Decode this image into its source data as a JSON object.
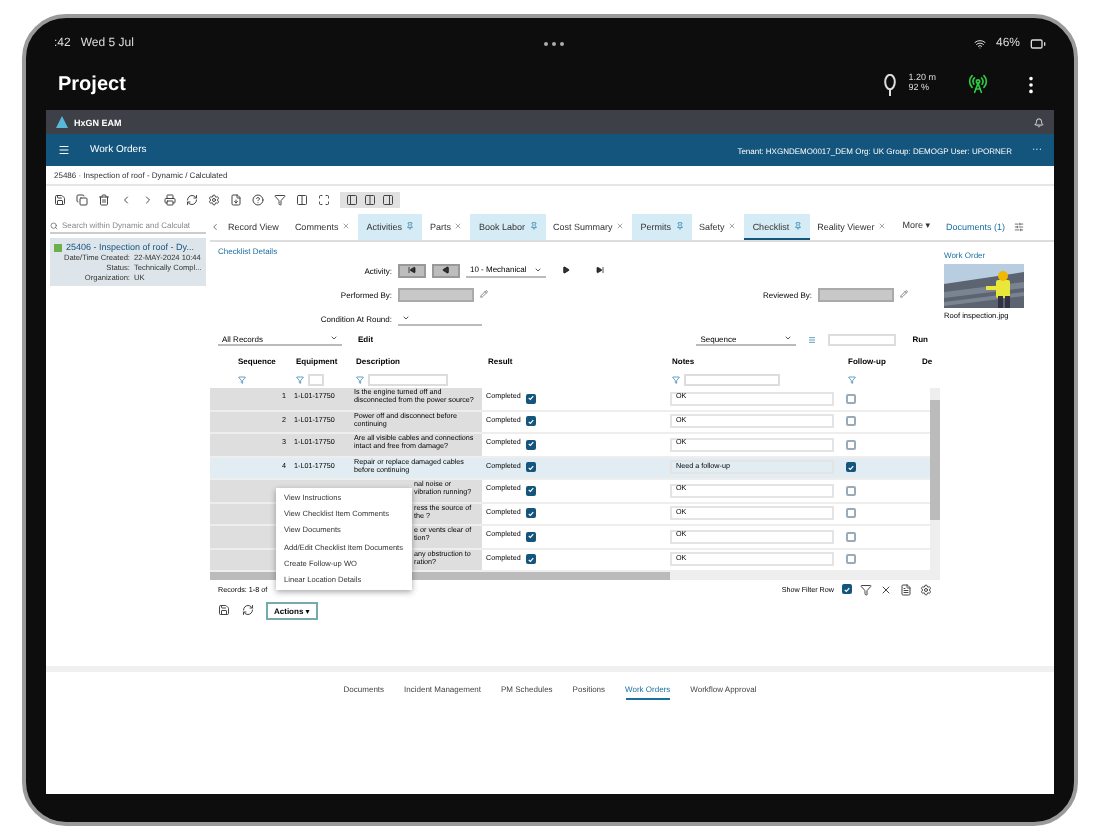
{
  "status_bar": {
    "time": ":42",
    "date": "Wed 5 Jul",
    "battery": "46%"
  },
  "app_header": {
    "title": "Project",
    "distance": "1.20 m",
    "accuracy": "92 %"
  },
  "eam_bar": {
    "brand": "HxGN EAM"
  },
  "nav_bar": {
    "title": "Work Orders",
    "session": "Tenant: HXGNDEMO0017_DEM Org: UK Group: DEMOGP User: UPORNER",
    "more": "···"
  },
  "breadcrumb": "25486 · Inspection of roof - Dynamic / Calculated",
  "list_panel": {
    "search_placeholder": "Search within Dynamic and Calculat",
    "record": {
      "title": "25406 - Inspection of roof - Dy...",
      "selected": true,
      "fields": [
        {
          "label": "Date/Time Created:",
          "value": "22-MAY-2024 10:44"
        },
        {
          "label": "Status:",
          "value": "Technically Compl..."
        },
        {
          "label": "Organization:",
          "value": "UK"
        }
      ]
    }
  },
  "tabs": [
    {
      "label": "Record View",
      "selected": false,
      "closable": false,
      "pinned": false
    },
    {
      "label": "Comments",
      "selected": false,
      "closable": true,
      "pinned": false
    },
    {
      "label": "Activities",
      "selected": false,
      "closable": false,
      "pinned": true
    },
    {
      "label": "Parts",
      "selected": false,
      "closable": true,
      "pinned": false
    },
    {
      "label": "Book Labor",
      "selected": false,
      "closable": false,
      "pinned": true
    },
    {
      "label": "Cost Summary",
      "selected": false,
      "closable": true,
      "pinned": false
    },
    {
      "label": "Permits",
      "selected": false,
      "closable": false,
      "pinned": true
    },
    {
      "label": "Safety",
      "selected": false,
      "closable": true,
      "pinned": false
    },
    {
      "label": "Checklist",
      "selected": true,
      "closable": false,
      "pinned": true
    },
    {
      "label": "Reality Viewer",
      "selected": false,
      "closable": true,
      "pinned": false
    }
  ],
  "more_tab": "More ▾",
  "documents_link": "Documents (1)",
  "side_panel": {
    "title": "Work Order",
    "caption": "Roof inspection.jpg"
  },
  "checklist": {
    "section_title": "Checklist Details",
    "activity_label": "Activity:",
    "activity_value": "10 - Mechanical",
    "performed_by_label": "Performed By:",
    "condition_label": "Condition At Round:",
    "reviewed_by_label": "Reviewed By:"
  },
  "grid": {
    "dataspy": "All Records",
    "edit": "Edit",
    "sort_field": "Sequence",
    "run": "Run",
    "columns": [
      "Sequence",
      "Equipment",
      "Description",
      "Result",
      "Notes",
      "Follow-up",
      "De"
    ],
    "rows": [
      {
        "sequence": "1",
        "equipment": "1-L01-17750",
        "description": "Is the engine turned off and disconnected from the power source?",
        "result": "Completed",
        "result_checked": true,
        "notes": "OK",
        "follow_up": false,
        "selected": false
      },
      {
        "sequence": "2",
        "equipment": "1-L01-17750",
        "description": "Power off and disconnect before continuing",
        "result": "Completed",
        "result_checked": true,
        "notes": "OK",
        "follow_up": false,
        "selected": false
      },
      {
        "sequence": "3",
        "equipment": "1-L01-17750",
        "description": "Are all visible cables and connections intact and free from damage?",
        "result": "Completed",
        "result_checked": true,
        "notes": "OK",
        "follow_up": false,
        "selected": false
      },
      {
        "sequence": "4",
        "equipment": "1-L01-17750",
        "description": "Repair or replace damaged cables before continuing",
        "result": "Completed",
        "result_checked": true,
        "notes": "Need a follow-up",
        "follow_up": true,
        "selected": true
      },
      {
        "description": "nal noise or vibration running?",
        "result": "Completed",
        "result_checked": true,
        "notes": "OK",
        "follow_up": false,
        "selected": false
      },
      {
        "description": "ress the source of the ?",
        "result": "Completed",
        "result_checked": true,
        "notes": "OK",
        "follow_up": false,
        "selected": false
      },
      {
        "description": "e or vents clear of tion?",
        "result": "Completed",
        "result_checked": true,
        "notes": "OK",
        "follow_up": false,
        "selected": false
      },
      {
        "description": "any obstruction to ration?",
        "result": "Completed",
        "result_checked": true,
        "notes": "OK",
        "follow_up": false,
        "selected": false
      }
    ],
    "records": "Records: 1-8 of",
    "show_filter_row": {
      "label": "Show Filter Row",
      "checked": true
    }
  },
  "actions_button": "Actions ▾",
  "context_menu": [
    "View Instructions",
    "View Checklist Item Comments",
    "View Documents",
    "Add/Edit Checklist Item Documents",
    "Create Follow-up WO",
    "Linear Location Details"
  ],
  "bottom_tabs": [
    {
      "label": "Documents",
      "selected": false
    },
    {
      "label": "Incident Management",
      "selected": false
    },
    {
      "label": "PM Schedules",
      "selected": false
    },
    {
      "label": "Positions",
      "selected": false
    },
    {
      "label": "Work Orders",
      "selected": true
    },
    {
      "label": "Workflow Approval",
      "selected": false
    }
  ]
}
